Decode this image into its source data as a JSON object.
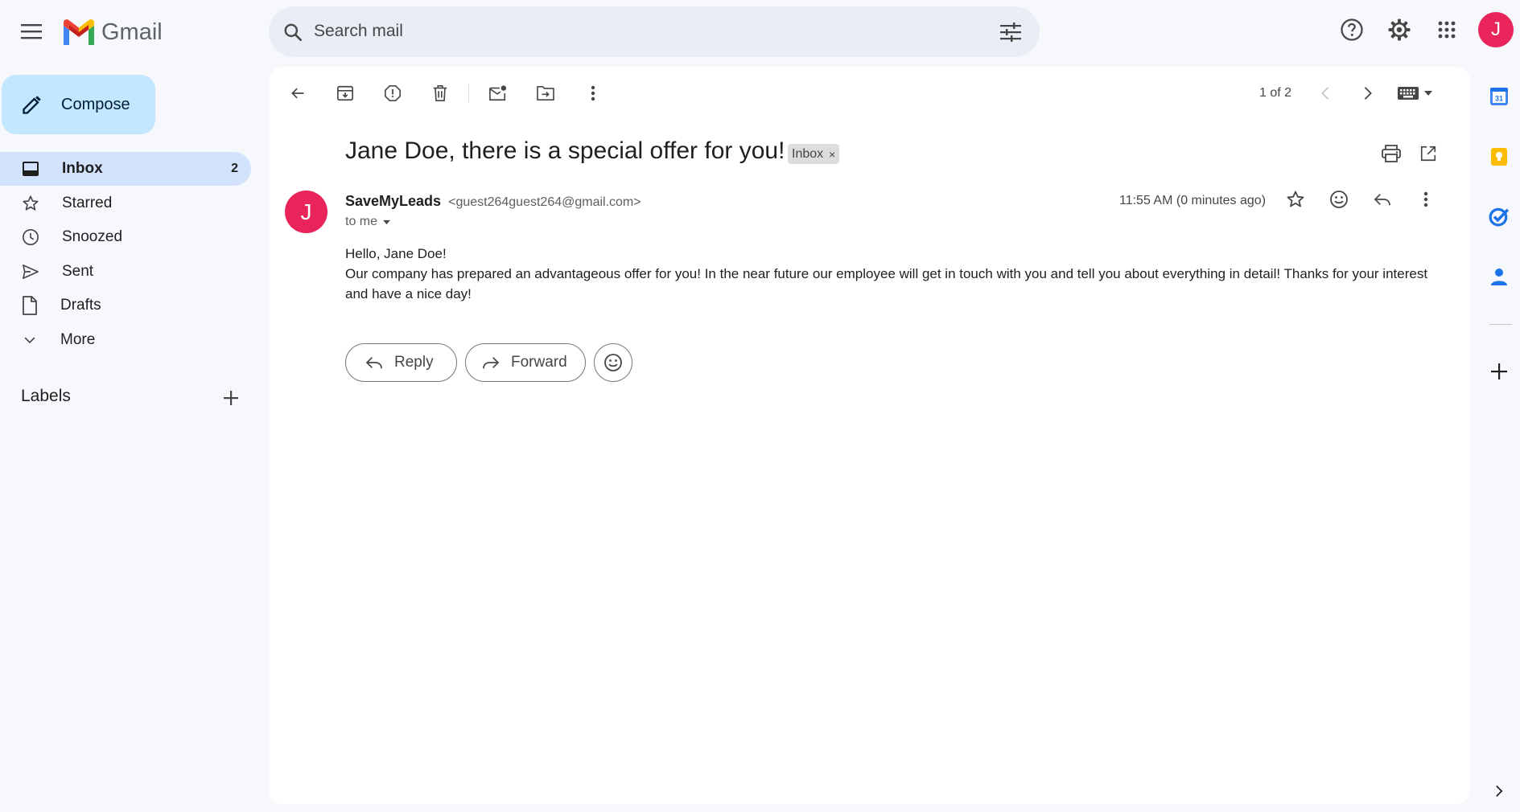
{
  "app": {
    "name": "Gmail"
  },
  "search": {
    "placeholder": "Search mail"
  },
  "header": {
    "avatar_letter": "J"
  },
  "sidebar": {
    "compose_label": "Compose",
    "items": [
      {
        "label": "Inbox",
        "count": "2",
        "icon": "inbox-icon",
        "active": true
      },
      {
        "label": "Starred",
        "count": "",
        "icon": "star-icon"
      },
      {
        "label": "Snoozed",
        "count": "",
        "icon": "clock-icon"
      },
      {
        "label": "Sent",
        "count": "",
        "icon": "send-icon"
      },
      {
        "label": "Drafts",
        "count": "",
        "icon": "draft-icon"
      },
      {
        "label": "More",
        "count": "",
        "icon": "chevron-down-icon"
      }
    ],
    "labels_heading": "Labels"
  },
  "toolbar": {
    "pager": "1 of 2"
  },
  "message": {
    "subject": "Jane Doe, there is a special offer for you!",
    "label_chip": "Inbox",
    "label_chip_close": "×",
    "sender_initial": "J",
    "sender_name": "SaveMyLeads",
    "sender_email": "<guest264guest264@gmail.com>",
    "recipient": "to me",
    "time": "11:55 AM (0 minutes ago)",
    "greeting": "Hello, Jane Doe!",
    "body": "Our company has prepared an advantageous offer for you! In the near future our employee will get in touch with you and tell you about everything in detail! Thanks for your interest and have a nice day!"
  },
  "actions": {
    "reply_label": "Reply",
    "forward_label": "Forward"
  },
  "colors": {
    "accent": "#c2e7ff",
    "active_nav": "#d3e3fd",
    "avatar": "#e8245b",
    "search_bg": "#e9eef6"
  }
}
